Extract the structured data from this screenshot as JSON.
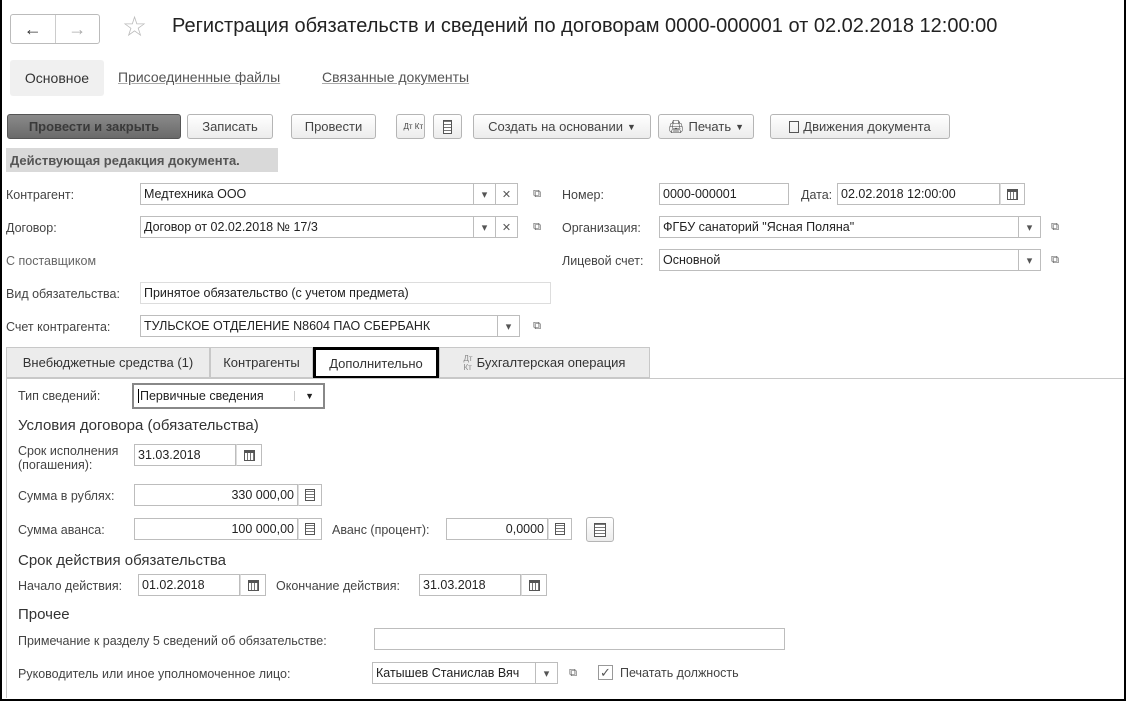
{
  "header": {
    "title": "Регистрация обязательств и сведений по договорам 0000-000001 от 02.02.2018 12:00:00"
  },
  "nav_tabs": [
    "Основное",
    "Присоединенные файлы",
    "Связанные документы"
  ],
  "toolbar": {
    "post_close": "Провести и закрыть",
    "save": "Записать",
    "post": "Провести",
    "dtkt": "Дт Кт",
    "create_based": "Создать на основании",
    "print": "Печать",
    "movements": "Движения документа"
  },
  "banner": "Действующая редакция документа.",
  "form": {
    "counterparty_label": "Контрагент:",
    "counterparty": "Медтехника ООО",
    "contract_label": "Договор:",
    "contract": "Договор от 02.02.2018 № 17/3",
    "number_label": "Номер:",
    "number": "0000-000001",
    "date_label": "Дата:",
    "date": "02.02.2018 12:00:00",
    "org_label": "Организация:",
    "org": "ФГБУ санаторий \"Ясная Поляна\"",
    "with_supplier": "С поставщиком",
    "account_label": "Лицевой счет:",
    "account": "Основной",
    "obligation_type_label": "Вид обязательства:",
    "obligation_type": "Принятое обязательство (с учетом предмета)",
    "cp_account_label": "Счет контрагента:",
    "cp_account": "ТУЛЬСКОЕ ОТДЕЛЕНИЕ N8604 ПАО СБЕРБАНК"
  },
  "tabs": [
    "Внебюджетные средства (1)",
    "Контрагенты",
    "Дополнительно",
    "Бухгалтерская операция"
  ],
  "extra": {
    "info_type_label": "Тип сведений:",
    "info_type": "Первичные сведения",
    "section1": "Условия договора (обязательства)",
    "due_label_1": "Срок исполнения",
    "due_label_2": "(погашения):",
    "due": "31.03.2018",
    "sum_label": "Сумма в рублях:",
    "sum": "330 000,00",
    "advance_label": "Сумма аванса:",
    "advance": "100 000,00",
    "advance_pct_label": "Аванс (процент):",
    "advance_pct": "0,0000",
    "section2": "Срок действия обязательства",
    "start_label": "Начало действия:",
    "start": "01.02.2018",
    "end_label": "Окончание действия:",
    "end": "31.03.2018",
    "section3": "Прочее",
    "note_label": "Примечание к разделу 5 сведений об обязательстве:",
    "note": "",
    "head_label": "Руководитель или иное уполномоченное лицо:",
    "head": "Катышев Станислав Вяч",
    "print_position": "Печатать должность",
    "print_position_checked": true
  }
}
